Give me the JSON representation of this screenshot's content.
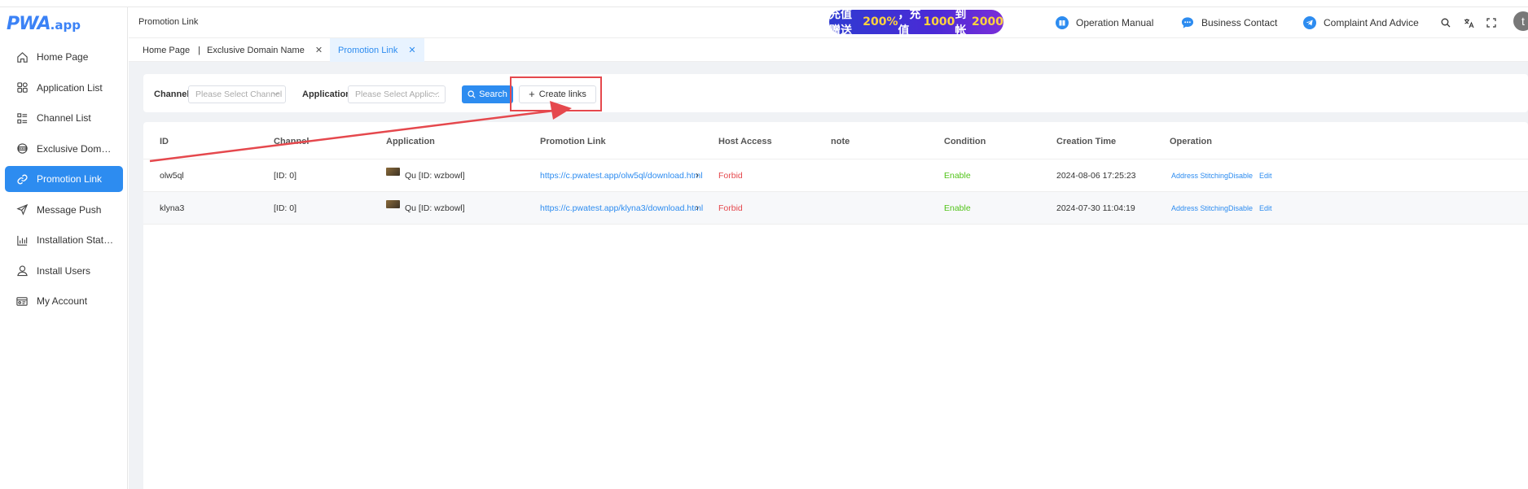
{
  "brand": {
    "logo_main": "PWA",
    "logo_suffix": ".app"
  },
  "sidebar": {
    "items": [
      {
        "label": "Home Page",
        "icon": "home-icon",
        "active": false
      },
      {
        "label": "Application List",
        "icon": "grid-icon",
        "active": false
      },
      {
        "label": "Channel List",
        "icon": "list-icon",
        "active": false
      },
      {
        "label": "Exclusive Domain…",
        "icon": "domain-icon",
        "active": false
      },
      {
        "label": "Promotion Link",
        "icon": "link-icon",
        "active": true
      },
      {
        "label": "Message Push",
        "icon": "send-icon",
        "active": false
      },
      {
        "label": "Installation Statist…",
        "icon": "bar-chart-icon",
        "active": false
      },
      {
        "label": "Install Users",
        "icon": "user-icon",
        "active": false
      },
      {
        "label": "My Account",
        "icon": "account-card-icon",
        "active": false
      }
    ]
  },
  "header": {
    "title": "Promotion Link",
    "banner": {
      "part1": "充值赠送",
      "pct": "200%",
      "part2": "，充值",
      "amt1": "1000",
      "part3": "到帐",
      "amt2": "2000"
    },
    "operation_manual": "Operation Manual",
    "business_contact": "Business Contact",
    "complaint": "Complaint And Advice",
    "avatar_letter": "t"
  },
  "tabs": [
    {
      "label": "Home Page"
    },
    {
      "label": "Exclusive Domain Name"
    },
    {
      "label": "Promotion Link"
    }
  ],
  "filters": {
    "channel_label": "Channel",
    "channel_placeholder": "Please Select Channel",
    "application_label": "Application",
    "application_placeholder": "Please Select Applic...",
    "search_label": "Search",
    "create_label": "Create links"
  },
  "table": {
    "headers": [
      "ID",
      "Channel",
      "Application",
      "Promotion Link",
      "Host Access",
      "note",
      "Condition",
      "Creation Time",
      "Operation"
    ],
    "rows": [
      {
        "id": "olw5ql",
        "channel": "[ID: 0]",
        "application": "Qu [ID: wzbowl]",
        "link": "https://c.pwatest.app/olw5ql/download.html",
        "host_access": "Forbid",
        "note": "",
        "condition": "Enable",
        "created": "2024-08-06 17:25:23",
        "op1": "Address Stitching",
        "op2": "Disable",
        "op3": "Edit"
      },
      {
        "id": "klyna3",
        "channel": "[ID: 0]",
        "application": "Qu [ID: wzbowl]",
        "link": "https://c.pwatest.app/klyna3/download.html",
        "host_access": "Forbid",
        "note": "",
        "condition": "Enable",
        "created": "2024-07-30 11:04:19",
        "op1": "Address Stitching",
        "op2": "Disable",
        "op3": "Edit"
      }
    ]
  },
  "colors": {
    "primary": "#2d8cf0",
    "forbid": "#e5484d",
    "enable": "#52c41a",
    "annotation": "#e5484d"
  }
}
